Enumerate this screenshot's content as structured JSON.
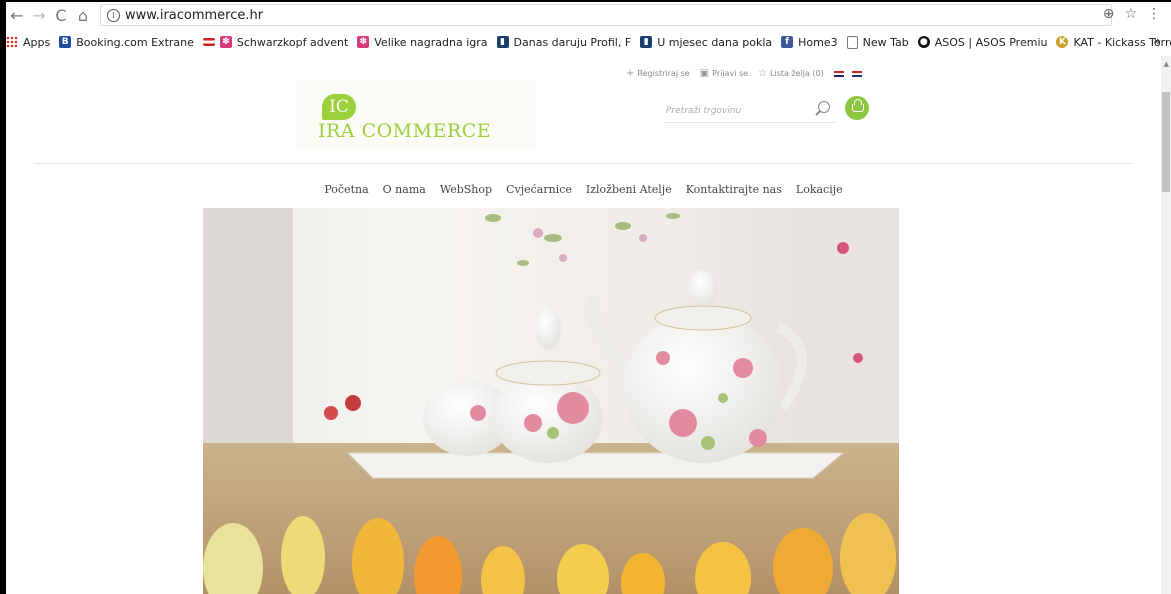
{
  "browser": {
    "back_label": "←",
    "forward_label": "→",
    "reload_label": "C",
    "home_label": "⌂",
    "url": "www.iracommerce.hr",
    "zoom_label": "⊕",
    "star_label": "☆",
    "menu_label": "⋮"
  },
  "bookmarks": {
    "apps_label": "Apps",
    "items": [
      {
        "label": "Booking.com Extrane",
        "icon": "booking-icon",
        "color": "#1f4e9c"
      },
      {
        "label": "Schwarzkopf advent",
        "icon": "schwarzkopf-icon",
        "color": "#d63b7a"
      },
      {
        "label": "Velike nagradna igra",
        "icon": "schwarzkopf-icon",
        "color": "#d63b7a"
      },
      {
        "label": "Danas daruju Profil, F",
        "icon": "bookmark-icon",
        "color": "#1a3f6f"
      },
      {
        "label": "U mjesec dana pokla",
        "icon": "bookmark-icon",
        "color": "#1a3f6f"
      },
      {
        "label": "Home3",
        "icon": "facebook-icon",
        "color": "#3b5998"
      },
      {
        "label": "New Tab",
        "icon": "page-icon",
        "color": "#ffffff"
      },
      {
        "label": "ASOS | ASOS Premiu",
        "icon": "asos-icon",
        "color": "#111111"
      },
      {
        "label": "KAT - Kickass Torrent",
        "icon": "kat-icon",
        "color": "#c9a227"
      }
    ],
    "more_label": "»"
  },
  "site": {
    "logo_monogram": "IC",
    "logo_text": "IRA COMMERCE",
    "utility": {
      "register": "Registriraj se",
      "login": "Prijavi se",
      "wishlist": "Lista želja (0)"
    },
    "search": {
      "placeholder": "Pretraži trgovinu"
    },
    "nav": [
      "Početna",
      "O nama",
      "WebShop",
      "Cvjećarnice",
      "Izložbeni Atelje",
      "Kontaktirajte nas",
      "Lokacije"
    ]
  },
  "colors": {
    "brand_green": "#8dc63f"
  }
}
